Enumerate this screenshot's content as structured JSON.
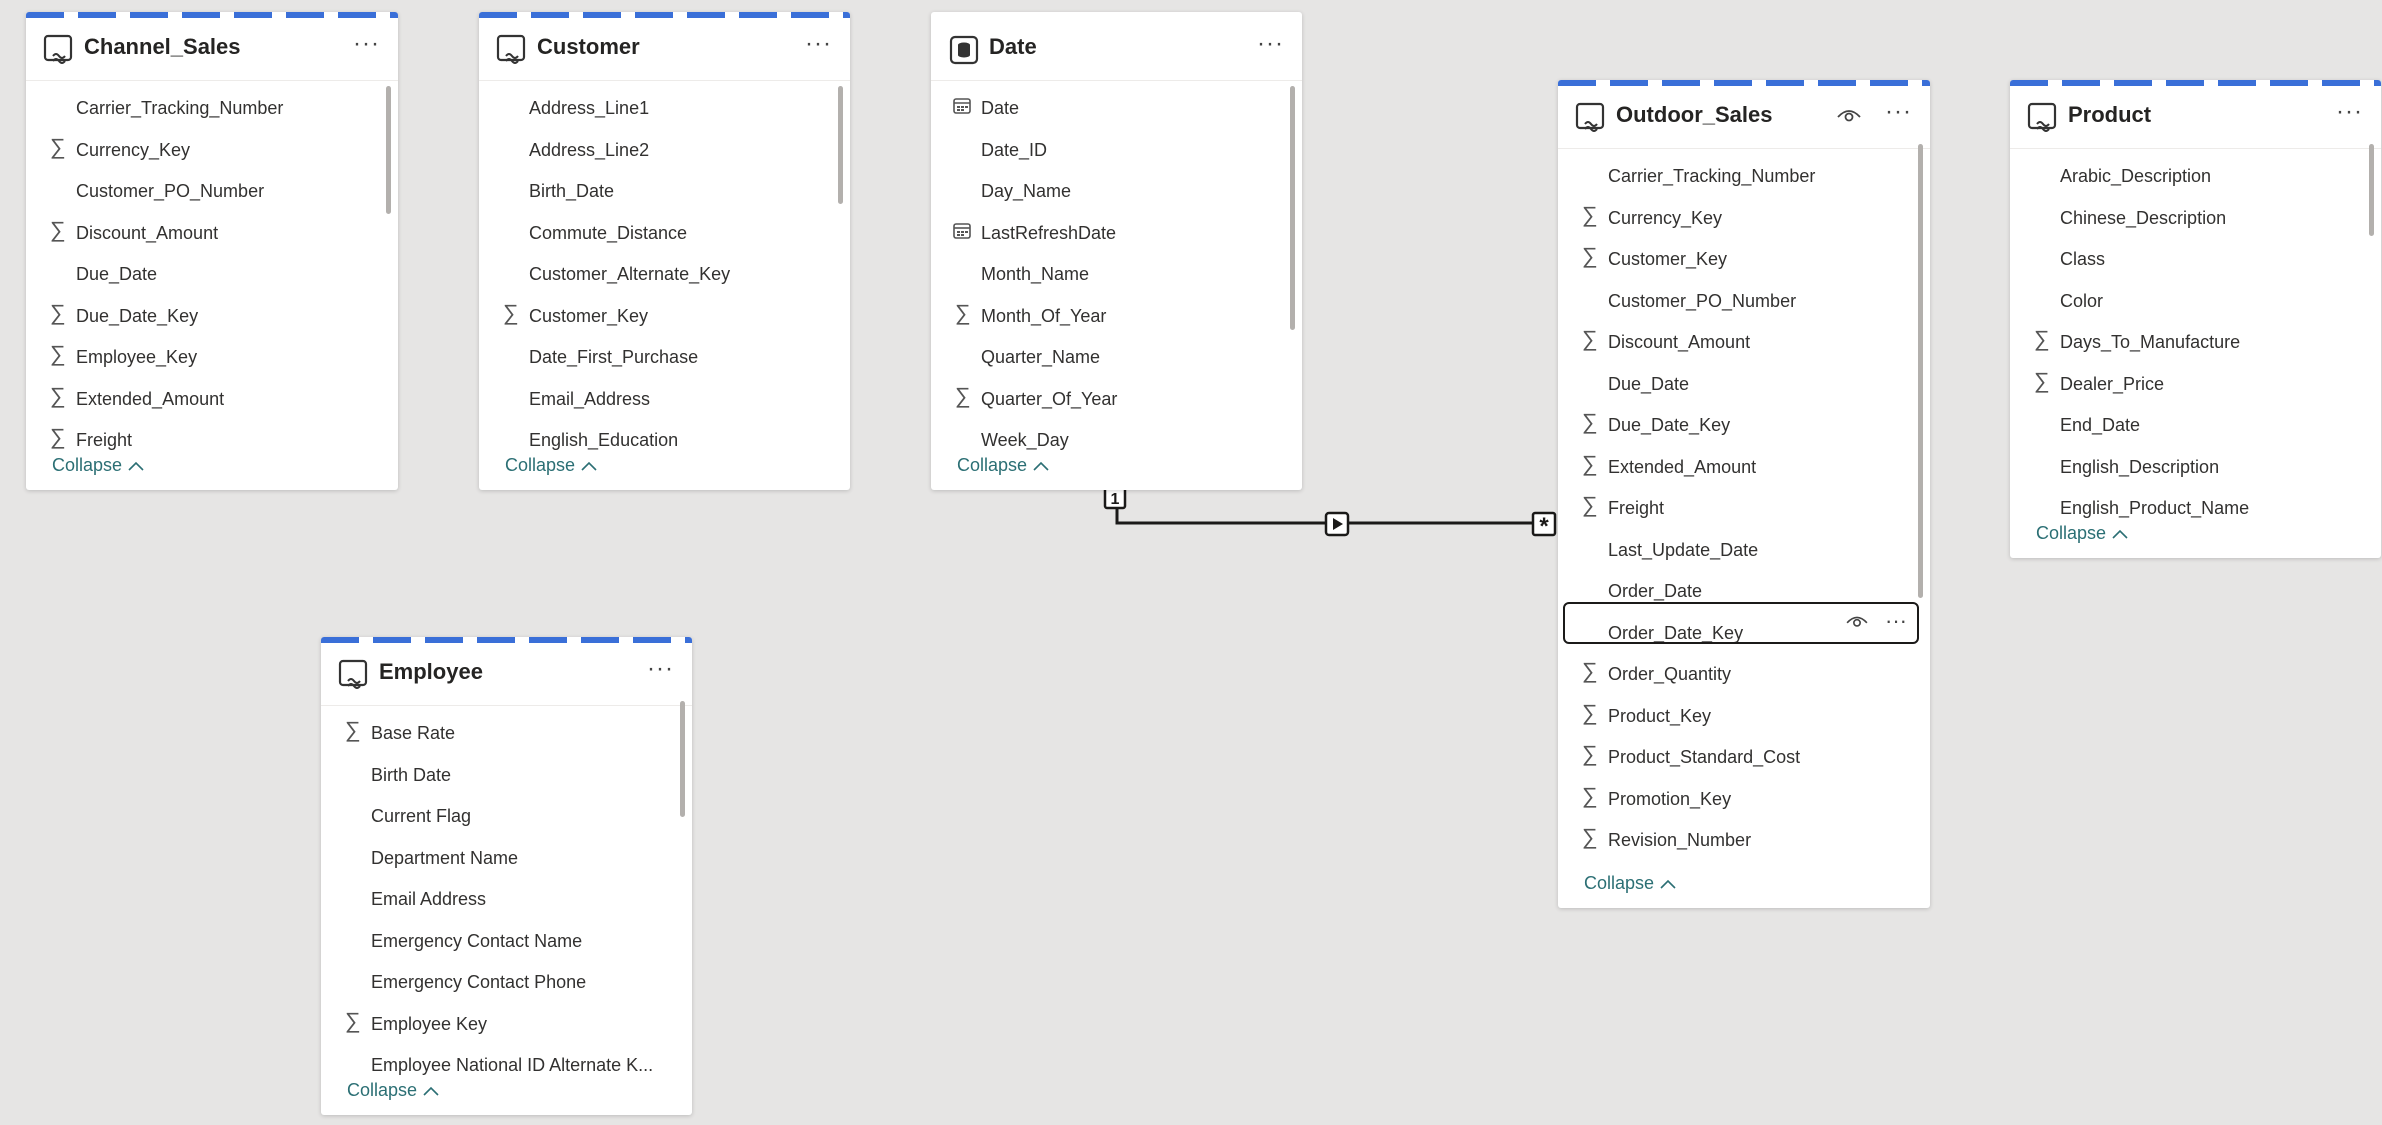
{
  "tables": {
    "channel_sales": {
      "title": "Channel_Sales",
      "more": "···",
      "collapse": "Collapse",
      "fields": [
        {
          "label": "Carrier_Tracking_Number",
          "icon": "none"
        },
        {
          "label": "Currency_Key",
          "icon": "sigma-icon"
        },
        {
          "label": "Customer_PO_Number",
          "icon": "none"
        },
        {
          "label": "Discount_Amount",
          "icon": "sigma-icon"
        },
        {
          "label": "Due_Date",
          "icon": "none"
        },
        {
          "label": "Due_Date_Key",
          "icon": "sigma-icon"
        },
        {
          "label": "Employee_Key",
          "icon": "sigma-icon"
        },
        {
          "label": "Extended_Amount",
          "icon": "sigma-icon"
        },
        {
          "label": "Freight",
          "icon": "sigma-icon"
        }
      ]
    },
    "customer": {
      "title": "Customer",
      "more": "···",
      "collapse": "Collapse",
      "fields": [
        {
          "label": "Address_Line1",
          "icon": "none"
        },
        {
          "label": "Address_Line2",
          "icon": "none"
        },
        {
          "label": "Birth_Date",
          "icon": "none"
        },
        {
          "label": "Commute_Distance",
          "icon": "none"
        },
        {
          "label": "Customer_Alternate_Key",
          "icon": "none"
        },
        {
          "label": "Customer_Key",
          "icon": "sigma-icon"
        },
        {
          "label": "Date_First_Purchase",
          "icon": "none"
        },
        {
          "label": "Email_Address",
          "icon": "none"
        },
        {
          "label": "English_Education",
          "icon": "none"
        }
      ]
    },
    "date": {
      "title": "Date",
      "more": "···",
      "collapse": "Collapse",
      "fields": [
        {
          "label": "Date",
          "icon": "calendar-icon"
        },
        {
          "label": "Date_ID",
          "icon": "none"
        },
        {
          "label": "Day_Name",
          "icon": "none"
        },
        {
          "label": "LastRefreshDate",
          "icon": "calendar-icon"
        },
        {
          "label": "Month_Name",
          "icon": "none"
        },
        {
          "label": "Month_Of_Year",
          "icon": "sigma-icon"
        },
        {
          "label": "Quarter_Name",
          "icon": "none"
        },
        {
          "label": "Quarter_Of_Year",
          "icon": "sigma-icon"
        },
        {
          "label": "Week_Day",
          "icon": "none"
        }
      ]
    },
    "outdoor_sales": {
      "title": "Outdoor_Sales",
      "more": "···",
      "collapse": "Collapse",
      "selected_field": "Order_Date_Key",
      "fields": [
        {
          "label": "Carrier_Tracking_Number",
          "icon": "none"
        },
        {
          "label": "Currency_Key",
          "icon": "sigma-icon"
        },
        {
          "label": "Customer_Key",
          "icon": "sigma-icon"
        },
        {
          "label": "Customer_PO_Number",
          "icon": "none"
        },
        {
          "label": "Discount_Amount",
          "icon": "sigma-icon"
        },
        {
          "label": "Due_Date",
          "icon": "none"
        },
        {
          "label": "Due_Date_Key",
          "icon": "sigma-icon"
        },
        {
          "label": "Extended_Amount",
          "icon": "sigma-icon"
        },
        {
          "label": "Freight",
          "icon": "sigma-icon"
        },
        {
          "label": "Last_Update_Date",
          "icon": "none"
        },
        {
          "label": "Order_Date",
          "icon": "none"
        },
        {
          "label": "Order_Date_Key",
          "icon": "none"
        },
        {
          "label": "Order_Quantity",
          "icon": "sigma-icon"
        },
        {
          "label": "Product_Key",
          "icon": "sigma-icon"
        },
        {
          "label": "Product_Standard_Cost",
          "icon": "sigma-icon"
        },
        {
          "label": "Promotion_Key",
          "icon": "sigma-icon"
        },
        {
          "label": "Revision_Number",
          "icon": "sigma-icon"
        }
      ]
    },
    "product": {
      "title": "Product",
      "more": "···",
      "collapse": "Collapse",
      "fields": [
        {
          "label": "Arabic_Description",
          "icon": "none"
        },
        {
          "label": "Chinese_Description",
          "icon": "none"
        },
        {
          "label": "Class",
          "icon": "none"
        },
        {
          "label": "Color",
          "icon": "none"
        },
        {
          "label": "Days_To_Manufacture",
          "icon": "sigma-icon"
        },
        {
          "label": "Dealer_Price",
          "icon": "sigma-icon"
        },
        {
          "label": "End_Date",
          "icon": "none"
        },
        {
          "label": "English_Description",
          "icon": "none"
        },
        {
          "label": "English_Product_Name",
          "icon": "none"
        }
      ]
    },
    "employee": {
      "title": "Employee",
      "more": "···",
      "collapse": "Collapse",
      "fields": [
        {
          "label": "Base Rate",
          "icon": "sigma-icon"
        },
        {
          "label": "Birth Date",
          "icon": "none"
        },
        {
          "label": "Current Flag",
          "icon": "none"
        },
        {
          "label": "Department Name",
          "icon": "none"
        },
        {
          "label": "Email Address",
          "icon": "none"
        },
        {
          "label": "Emergency Contact Name",
          "icon": "none"
        },
        {
          "label": "Emergency Contact Phone",
          "icon": "none"
        },
        {
          "label": "Employee Key",
          "icon": "sigma-icon"
        },
        {
          "label": "Employee National ID Alternate K..."
        }
      ]
    }
  },
  "relationship": {
    "from_table": "Date",
    "to_table": "Outdoor_Sales",
    "from_cardinality": "1",
    "to_cardinality": "*",
    "direction": "single"
  },
  "colors": {
    "canvas": "#e6e5e4",
    "card": "#ffffff",
    "directquery_stripe": "#3a6fd8",
    "collapse_link": "#2b6f74"
  }
}
